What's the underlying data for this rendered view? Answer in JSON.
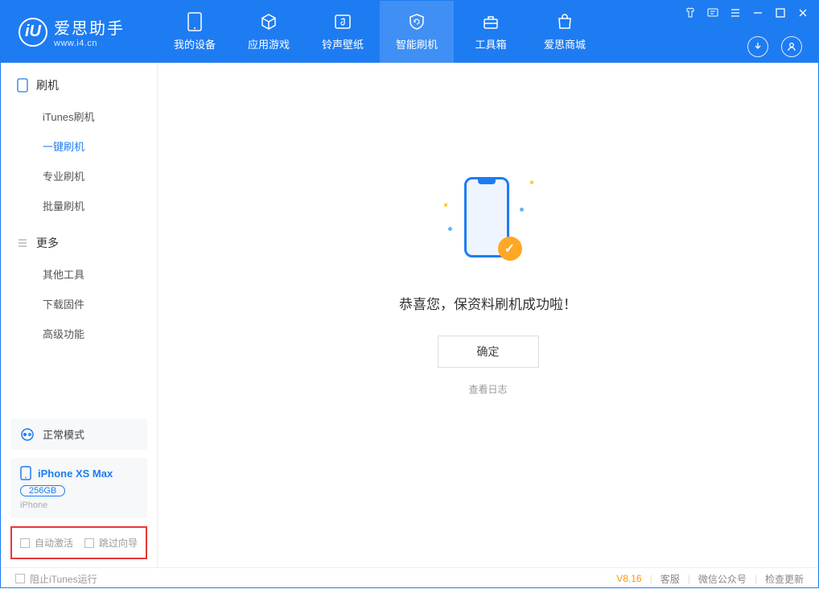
{
  "logo": {
    "glyph": "iU",
    "title": "爱思助手",
    "sub": "www.i4.cn"
  },
  "nav": {
    "tabs": [
      {
        "label": "我的设备"
      },
      {
        "label": "应用游戏"
      },
      {
        "label": "铃声壁纸"
      },
      {
        "label": "智能刷机"
      },
      {
        "label": "工具箱"
      },
      {
        "label": "爱思商城"
      }
    ]
  },
  "sidebar": {
    "sections": [
      {
        "title": "刷机",
        "items": [
          {
            "label": "iTunes刷机"
          },
          {
            "label": "一键刷机"
          },
          {
            "label": "专业刷机"
          },
          {
            "label": "批量刷机"
          }
        ]
      },
      {
        "title": "更多",
        "items": [
          {
            "label": "其他工具"
          },
          {
            "label": "下载固件"
          },
          {
            "label": "高级功能"
          }
        ]
      }
    ],
    "mode": "正常模式",
    "device": {
      "name": "iPhone XS Max",
      "capacity": "256GB",
      "type": "iPhone"
    },
    "options": {
      "auto_activate": "自动激活",
      "skip_guide": "跳过向导"
    }
  },
  "main": {
    "success_msg": "恭喜您，保资料刷机成功啦！",
    "ok_button": "确定",
    "view_log": "查看日志"
  },
  "footer": {
    "block_itunes": "阻止iTunes运行",
    "version": "V8.16",
    "links": {
      "service": "客服",
      "wechat": "微信公众号",
      "update": "检查更新"
    }
  }
}
